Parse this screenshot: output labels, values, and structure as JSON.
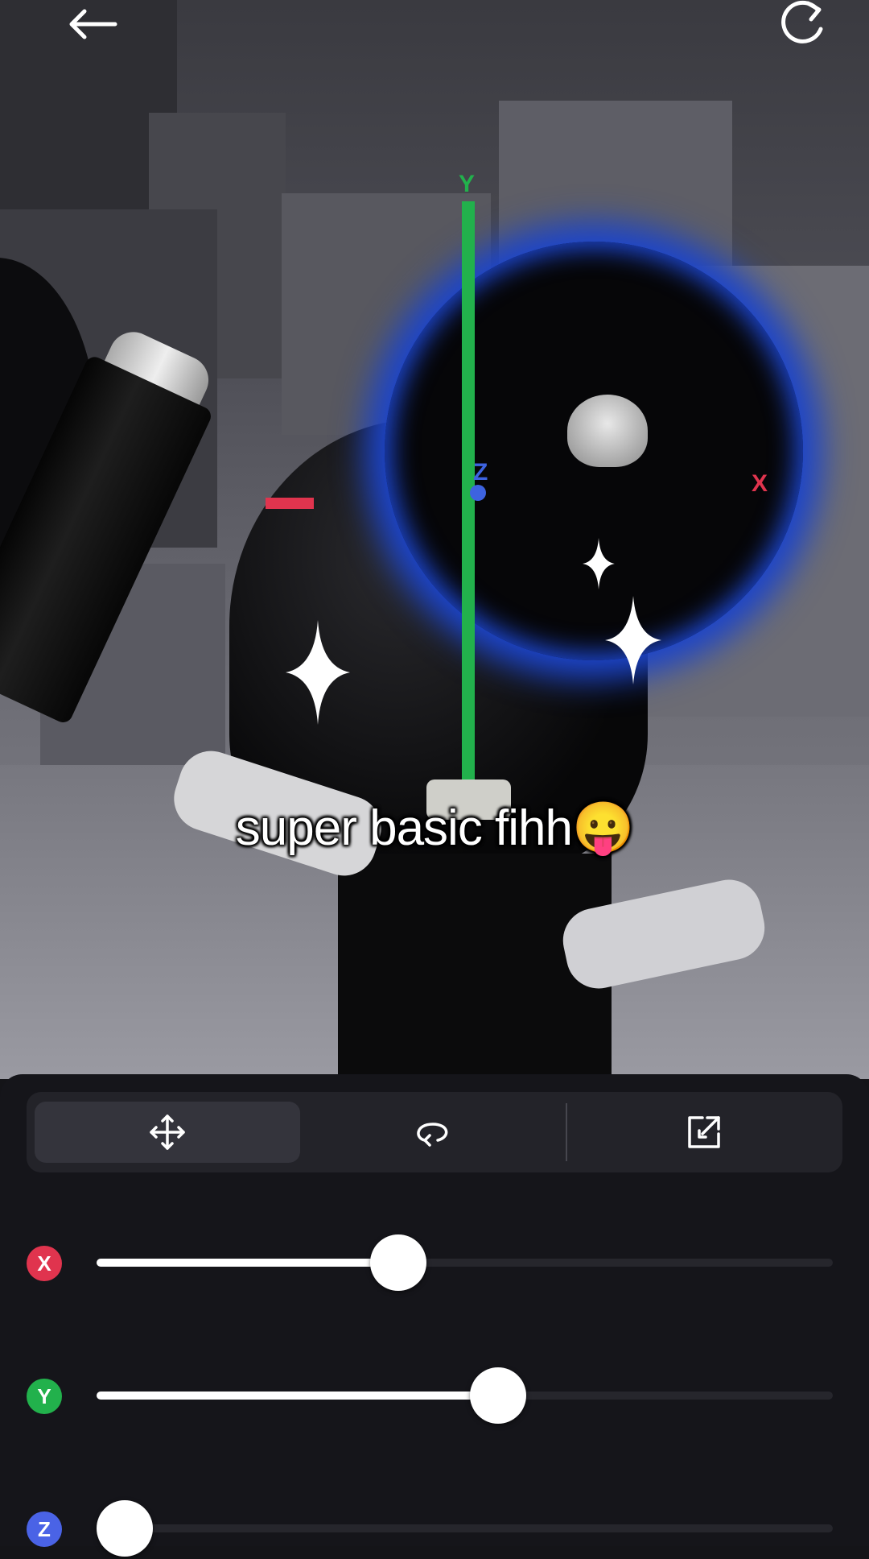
{
  "topbar": {
    "back_icon": "arrow-left-icon",
    "reset_icon": "refresh-icon"
  },
  "scene": {
    "gizmo": {
      "y_label": "Y",
      "x_label": "X",
      "z_label": "Z",
      "colors": {
        "x": "#e0344e",
        "y": "#22b14c",
        "z": "#3d63e0",
        "ring": "#1d45c9"
      }
    }
  },
  "caption": {
    "text": "super basic fihh😛"
  },
  "panel": {
    "modes": [
      {
        "name": "move",
        "icon": "move-arrows-icon",
        "active": true
      },
      {
        "name": "rotate",
        "icon": "rotate-icon",
        "active": false
      },
      {
        "name": "export",
        "icon": "open-external-icon",
        "active": false
      }
    ],
    "sliders": [
      {
        "axis": "X",
        "color": "#e0344e",
        "value": 0.41
      },
      {
        "axis": "Y",
        "color": "#22b14c",
        "value": 0.545
      },
      {
        "axis": "Z",
        "color": "#4a63e6",
        "value": 0.0
      }
    ]
  }
}
